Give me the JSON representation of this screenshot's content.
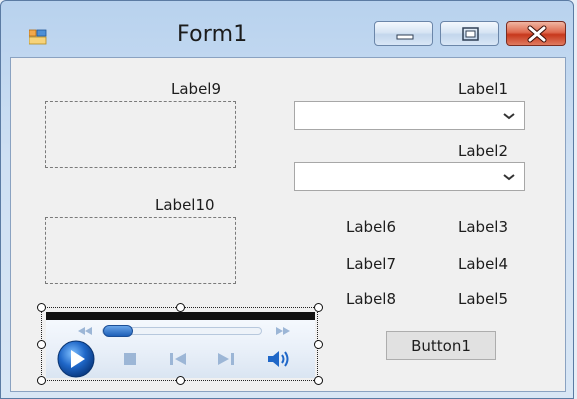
{
  "window": {
    "title": "Form1"
  },
  "labels": {
    "label9": "Label9",
    "label10": "Label10",
    "label1": "Label1",
    "label2": "Label2",
    "label3": "Label3",
    "label4": "Label4",
    "label5": "Label5",
    "label6": "Label6",
    "label7": "Label7",
    "label8": "Label8"
  },
  "button1": {
    "label": "Button1"
  },
  "comboboxes": [
    {
      "value": ""
    },
    {
      "value": ""
    }
  ],
  "icons": {
    "app": "form-app-icon",
    "minimize": "minimize-icon",
    "maximize": "maximize-icon",
    "close": "close-icon",
    "combo_arrow": "chevron-down-icon",
    "play": "play-icon",
    "stop": "stop-icon",
    "previous": "previous-track-icon",
    "next": "next-track-icon",
    "volume": "volume-icon",
    "rewind": "rewind-icon",
    "fast_forward": "fast-forward-icon"
  },
  "colors": {
    "title_bar": "#b8d2ee",
    "close_button": "#c7381c",
    "client_background": "#f0f0f0",
    "player_play_button": "#1f67c8"
  },
  "media_player": {
    "seek_position": 0.2
  }
}
